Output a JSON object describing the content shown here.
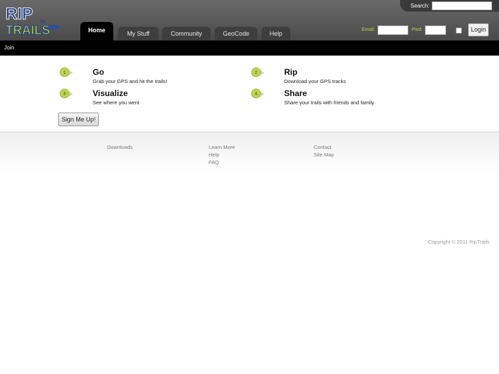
{
  "header": {
    "logo_alt": "RIP TRAILS",
    "logo_line1": "RIP",
    "logo_line2": "TRAILS",
    "search_label": "Search:",
    "search_value": ""
  },
  "tabs": [
    {
      "label": "Home"
    },
    {
      "label": "My Stuff"
    },
    {
      "label": "Community"
    },
    {
      "label": "GeoCode"
    },
    {
      "label": "Help"
    }
  ],
  "login": {
    "email_label": "Email:",
    "email_value": "",
    "pwd_label": "Pwd:",
    "pwd_value": "",
    "button": "Login"
  },
  "subnav": {
    "join": "Join"
  },
  "steps": [
    {
      "number": "1",
      "title": "Go",
      "desc": "Grab your GPS and hit the trails!"
    },
    {
      "number": "2",
      "title": "Rip",
      "desc": "Download your GPS tracks"
    },
    {
      "number": "3",
      "title": "Visualize",
      "desc": "See where you went"
    },
    {
      "number": "4",
      "title": "Share",
      "desc": "Share your trails with friends and family"
    }
  ],
  "signup_button": "Sign Me Up!",
  "footer": {
    "col1": [
      "Downloads"
    ],
    "col2": [
      "Learn More",
      "Help",
      "FAQ"
    ],
    "col3": [
      "Contact",
      "Site Map"
    ],
    "copyright": "Copyright © 2011 RipTrails"
  },
  "colors": {
    "accent": "#b9d74a",
    "badge": "#a8c93a",
    "header": "#555555"
  }
}
